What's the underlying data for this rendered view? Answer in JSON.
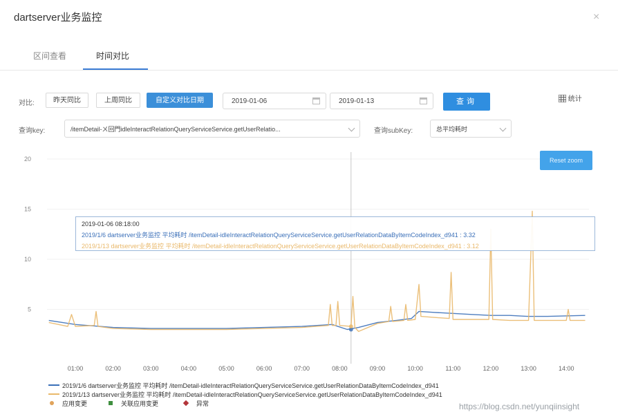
{
  "window": {
    "title": "dartserver业务监控",
    "close_icon": "×"
  },
  "tabs": [
    {
      "label": "区间查看",
      "active": false
    },
    {
      "label": "时间对比",
      "active": true
    }
  ],
  "toolbar": {
    "compare_label": "对比:",
    "yesterday_btn": "昨天同比",
    "lastweek_btn": "上周同比",
    "custom_btn": "自定义对比日期",
    "date1": "2019-01-06",
    "date2": "2019-01-13",
    "query_btn": "查询",
    "stat_label": "统计",
    "stat_icon": "grid-icon"
  },
  "filters": {
    "key_label": "查询key:",
    "key_value": "/itemDetail-ㄨ回門idleInteractRelationQueryServiceService.getUserRelatio...",
    "subkey_label": "查询subKey:",
    "subkey_value": "总平均耗时"
  },
  "chart_controls": {
    "reset_zoom": "Reset zoom"
  },
  "tooltip": {
    "time": "2019-01-06 08:18:00",
    "rows": [
      {
        "text": "2019/1/6 dartserver业务监控 平均耗时 /itemDetail-idleInteractRelationQueryServiceService.getUserRelationDataByItemCodeIndex_d941 : 3.32",
        "color": "#3a6fb8"
      },
      {
        "text": "2019/1/13 dartserver业务监控 平均耗时 /itemDetail-idleInteractRelationQueryServiceService.getUserRelationDataByItemCodeIndex_d941 : 3.12",
        "color": "#e9b86a"
      }
    ]
  },
  "legend": {
    "series1": "2019/1/6 dartserver业务监控 平均耗时 /itemDetail-idleInteractRelationQueryServiceService.getUserRelationDataByItemCodeIndex_d941",
    "series2": "2019/1/13 dartserver业务监控 平均耗时 /itemDetail-idleInteractRelationQueryServiceService.getUserRelationDataByItemCodeIndex_d941",
    "markers": [
      {
        "label": "应用变更",
        "color": "#e0a35a",
        "shape": "circle"
      },
      {
        "label": "关联应用变更",
        "color": "#3f8f3f",
        "shape": "square"
      },
      {
        "label": "异常",
        "color": "#b3353a",
        "shape": "diamond"
      }
    ]
  },
  "watermark": "https://blog.csdn.net/yunqiinsight",
  "colors": {
    "series1": "#3a6fb8",
    "series2": "#e9b86a",
    "accent": "#3b8fd9"
  },
  "chart_data": {
    "type": "line",
    "x_ticks": [
      "01:00",
      "02:00",
      "03:00",
      "04:00",
      "05:00",
      "06:00",
      "07:00",
      "08:00",
      "09:00",
      "10:00",
      "11:00",
      "12:00",
      "13:00",
      "14:00"
    ],
    "y_ticks": [
      "20",
      "15",
      "10",
      "5"
    ],
    "ylim": [
      0,
      20
    ],
    "xlim": [
      0.25,
      14.6
    ],
    "crosshair_x": 8.3,
    "series": [
      {
        "name": "2019/1/6 dartserver业务监控 平均耗时 /itemDetail-idleInteractRelationQueryServiceService.getUserRelationDataByItemCodeIndex_d941",
        "points": [
          [
            0.3,
            3.9
          ],
          [
            1,
            3.5
          ],
          [
            2,
            3.2
          ],
          [
            3,
            3.1
          ],
          [
            4,
            3.1
          ],
          [
            5,
            3.1
          ],
          [
            6,
            3.2
          ],
          [
            7,
            3.3
          ],
          [
            7.8,
            3.5
          ],
          [
            8.2,
            3.0
          ],
          [
            8.5,
            3.2
          ],
          [
            9,
            3.7
          ],
          [
            9.5,
            3.9
          ],
          [
            9.9,
            4.1
          ],
          [
            10.1,
            4.8
          ],
          [
            10.5,
            4.7
          ],
          [
            11,
            4.6
          ],
          [
            11.5,
            4.5
          ],
          [
            12,
            4.4
          ],
          [
            12.5,
            4.4
          ],
          [
            13,
            4.3
          ],
          [
            13.5,
            4.3
          ],
          [
            14.5,
            4.4
          ]
        ]
      },
      {
        "name": "2019/1/13 dartserver业务监控 平均耗时 /itemDetail-idleInteractRelationQueryServiceService.getUserRelationDataByItemCodeIndex_d941",
        "points": [
          [
            0.3,
            3.7
          ],
          [
            0.8,
            3.3
          ],
          [
            0.9,
            4.5
          ],
          [
            1,
            3.3
          ],
          [
            1.5,
            3.4
          ],
          [
            1.55,
            4.8
          ],
          [
            1.6,
            3.3
          ],
          [
            2,
            3.1
          ],
          [
            3,
            3.0
          ],
          [
            4,
            3.0
          ],
          [
            5,
            3.0
          ],
          [
            6,
            3.1
          ],
          [
            7,
            3.2
          ],
          [
            7.7,
            3.4
          ],
          [
            7.75,
            5.5
          ],
          [
            7.8,
            3.4
          ],
          [
            7.9,
            3.4
          ],
          [
            7.95,
            5.8
          ],
          [
            8.0,
            3.4
          ],
          [
            8.3,
            3.3
          ],
          [
            8.35,
            6.3
          ],
          [
            8.4,
            3.2
          ],
          [
            8.5,
            2.8
          ],
          [
            9,
            3.6
          ],
          [
            9.3,
            3.8
          ],
          [
            9.35,
            5.3
          ],
          [
            9.4,
            3.8
          ],
          [
            9.7,
            3.9
          ],
          [
            9.75,
            5.5
          ],
          [
            9.8,
            3.9
          ],
          [
            10,
            4.0
          ],
          [
            10.1,
            7.5
          ],
          [
            10.15,
            4.3
          ],
          [
            10.5,
            4.2
          ],
          [
            10.9,
            4.1
          ],
          [
            10.95,
            8.7
          ],
          [
            11,
            4.0
          ],
          [
            11.5,
            4.0
          ],
          [
            11.95,
            4.0
          ],
          [
            12.0,
            13.0
          ],
          [
            12.05,
            4.0
          ],
          [
            12.5,
            3.9
          ],
          [
            13.0,
            3.9
          ],
          [
            13.1,
            14.8
          ],
          [
            13.15,
            3.9
          ],
          [
            13.5,
            3.9
          ],
          [
            14.0,
            3.9
          ],
          [
            14.05,
            5.0
          ],
          [
            14.1,
            3.9
          ],
          [
            14.5,
            3.9
          ]
        ]
      }
    ]
  }
}
